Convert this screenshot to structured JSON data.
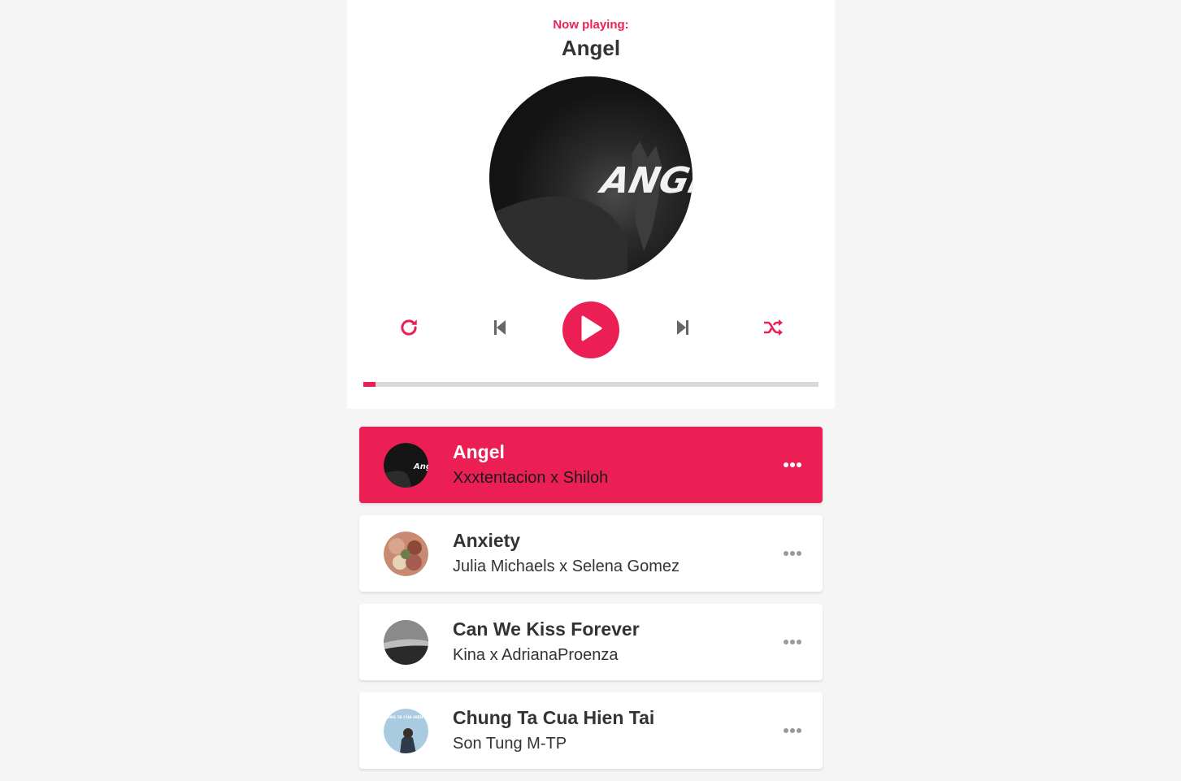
{
  "player": {
    "now_label": "Now playing:",
    "title": "Angel",
    "cd_art_text": "ANGE",
    "progress": 0.027
  },
  "colors": {
    "accent": "#ec1f55",
    "control_gray": "#666666",
    "text": "#333333",
    "option_gray": "#999999",
    "active_option": "#ffffff"
  },
  "controls": {
    "repeat_icon": "repeat-icon",
    "prev_icon": "step-backward-icon",
    "play_icon": "play-icon",
    "next_icon": "step-forward-icon",
    "random_icon": "shuffle-icon"
  },
  "playlist": [
    {
      "title": "Angel",
      "author": "Xxxtentacion x Shiloh",
      "active": true,
      "thumb_text": "Ange"
    },
    {
      "title": "Anxiety",
      "author": "Julia Michaels x Selena Gomez",
      "active": false
    },
    {
      "title": "Can We Kiss Forever",
      "author": "Kina x AdrianaProenza",
      "active": false
    },
    {
      "title": "Chung Ta Cua Hien Tai",
      "author": "Son Tung M-TP",
      "active": false,
      "thumb_text": "CHÚNG TA CỦA HIỆN TẠI"
    }
  ]
}
